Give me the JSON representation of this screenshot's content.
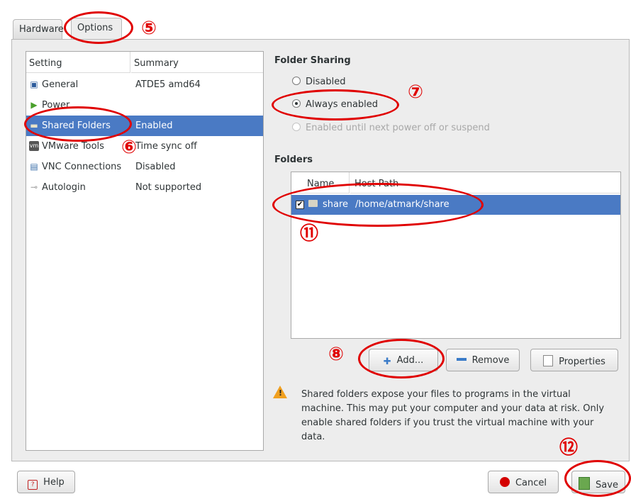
{
  "tabs": [
    {
      "label": "Hardware"
    },
    {
      "label": "Options"
    }
  ],
  "settings": {
    "columns": [
      "Setting",
      "Summary"
    ],
    "rows": [
      {
        "label": "General",
        "summary": "ATDE5 amd64",
        "icon": "general-icon"
      },
      {
        "label": "Power",
        "summary": "",
        "icon": "power-icon"
      },
      {
        "label": "Shared Folders",
        "summary": "Enabled",
        "icon": "shared-folders-icon",
        "selected": true
      },
      {
        "label": "VMware Tools",
        "summary": "Time sync off",
        "icon": "vmware-tools-icon"
      },
      {
        "label": "VNC Connections",
        "summary": "Disabled",
        "icon": "vnc-icon"
      },
      {
        "label": "Autologin",
        "summary": "Not supported",
        "icon": "autologin-icon"
      }
    ]
  },
  "folder_sharing": {
    "heading": "Folder Sharing",
    "options": [
      {
        "label": "Disabled",
        "checked": false,
        "enabled": true
      },
      {
        "label": "Always enabled",
        "checked": true,
        "enabled": true
      },
      {
        "label": "Enabled until next power off or suspend",
        "checked": false,
        "enabled": false
      }
    ]
  },
  "folders": {
    "heading": "Folders",
    "columns": [
      "Name",
      "Host Path"
    ],
    "rows": [
      {
        "checked": true,
        "name": "share",
        "path": "/home/atmark/share"
      }
    ]
  },
  "buttons": {
    "add": "Add...",
    "remove": "Remove",
    "properties": "Properties",
    "help": "Help",
    "cancel": "Cancel",
    "save": "Save"
  },
  "warning": {
    "lines": [
      "Shared folders expose your files to programs in the virtual",
      "machine. This may put your computer and your data at risk. Only",
      "enable shared folders if you trust the virtual machine with your",
      "data."
    ]
  },
  "annotations": [
    "⑤",
    "⑥",
    "⑦",
    "⑧",
    "⑪",
    "⑫"
  ],
  "colors": {
    "selection": "#4a7ac4",
    "annotation": "#e00000"
  }
}
